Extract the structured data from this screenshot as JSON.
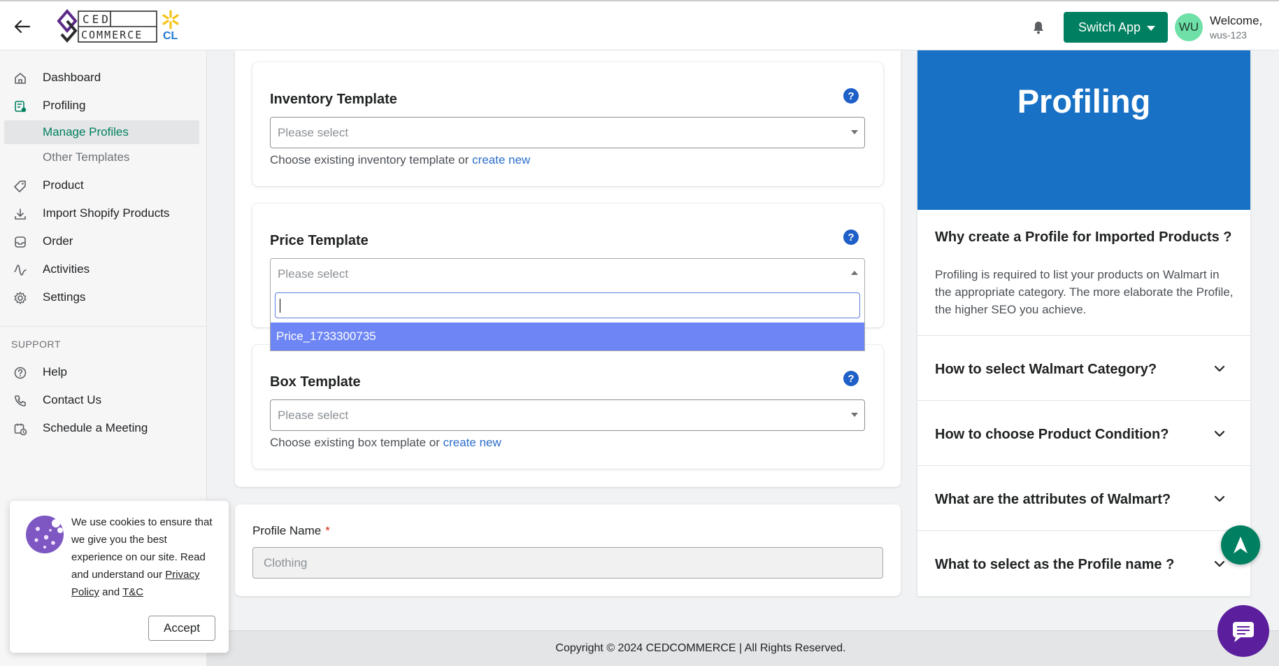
{
  "header": {
    "logo_line1": "CED",
    "logo_line2": "COMMERCE",
    "logo_badge": "CL",
    "switch_app_label": "Switch App",
    "avatar_initials": "WU",
    "welcome_label": "Welcome,",
    "username": "wus-123"
  },
  "sidebar": {
    "items": [
      {
        "label": "Dashboard",
        "icon": "home-icon"
      },
      {
        "label": "Profiling",
        "icon": "profile-list-icon"
      },
      {
        "label": "Product",
        "icon": "tag-icon"
      },
      {
        "label": "Import Shopify Products",
        "icon": "download-icon"
      },
      {
        "label": "Order",
        "icon": "inbox-icon"
      },
      {
        "label": "Activities",
        "icon": "activity-icon"
      },
      {
        "label": "Settings",
        "icon": "gear-icon"
      }
    ],
    "sub_items": [
      {
        "label": "Manage Profiles",
        "active": true
      },
      {
        "label": "Other Templates",
        "active": false
      }
    ],
    "support_title": "SUPPORT",
    "support_items": [
      {
        "label": "Help",
        "icon": "help-circle-icon"
      },
      {
        "label": "Contact Us",
        "icon": "phone-icon"
      },
      {
        "label": "Schedule a Meeting",
        "icon": "calendar-clock-icon"
      }
    ]
  },
  "main": {
    "inventory": {
      "title": "Inventory Template",
      "placeholder": "Please select",
      "hint_text": "Choose existing inventory template or ",
      "hint_link": "create new"
    },
    "price": {
      "title": "Price Template",
      "placeholder": "Please select",
      "dropdown_options": [
        "Price_1733300735"
      ]
    },
    "box": {
      "title": "Box Template",
      "placeholder": "Please select",
      "hint_text": "Choose existing box template or ",
      "hint_link": "create new"
    },
    "profile_name": {
      "label": "Profile Name",
      "required_mark": "*",
      "value": "Clothing"
    }
  },
  "right_panel": {
    "banner_title": "Profiling",
    "open_faq": {
      "question": "Why create a Profile for Imported Products ?",
      "answer": "Profiling is required to list your products on Walmart in the appropriate category. The more elaborate the Profile, the higher SEO you achieve."
    },
    "faqs": [
      "How to select Walmart Category?",
      "How to choose Product Condition?",
      "What are the attributes of Walmart?",
      "What to select as the Profile name ?"
    ]
  },
  "footer": {
    "copyright": "Copyright © 2024 CEDCOMMERCE | All Rights Reserved."
  },
  "cookie": {
    "text_pre": "We use cookies to ensure that we give you the best experience on our site. Read and understand our ",
    "privacy_link": "Privacy Policy",
    "and": " and ",
    "tc_link": "T&C",
    "accept_label": "Accept"
  },
  "colors": {
    "primary_green": "#008060",
    "banner_blue": "#1871c4",
    "link_blue": "#2c6ecb",
    "option_highlight": "#6e86f5",
    "chat_purple": "#5b1f9e"
  }
}
